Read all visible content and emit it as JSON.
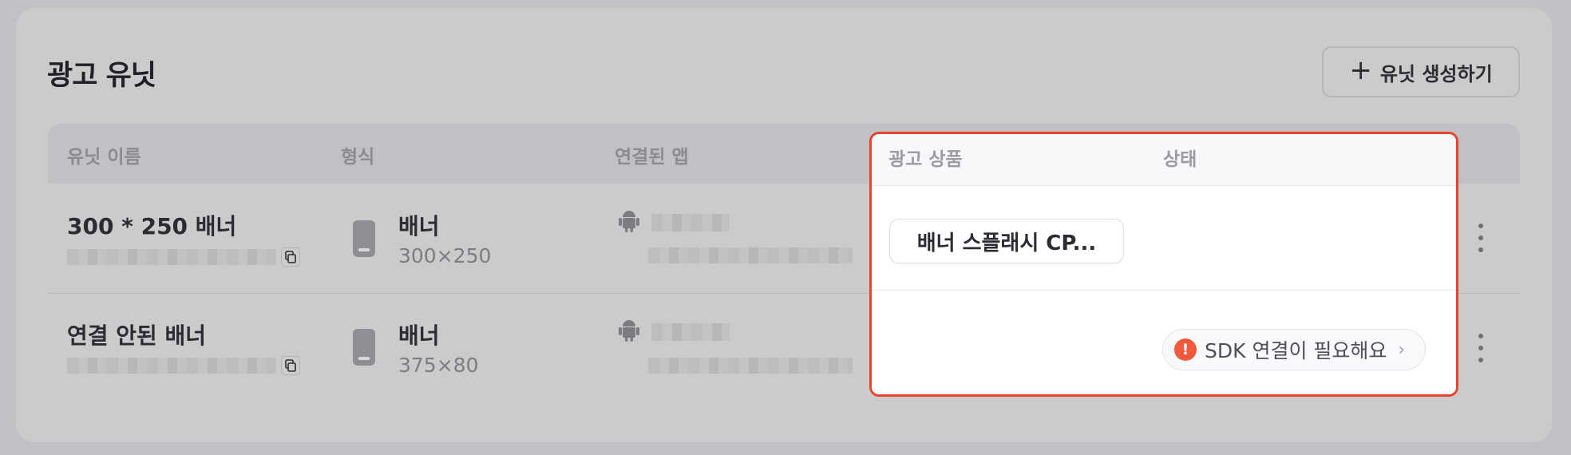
{
  "header": {
    "title": "광고 유닛",
    "create_button": "유닛 생성하기"
  },
  "table": {
    "columns": {
      "name": "유닛 이름",
      "format": "형식",
      "app": "연결된 앱",
      "product": "광고 상품",
      "status": "상태"
    },
    "rows": [
      {
        "name": "300 * 250 배너",
        "format": "배너",
        "size": "300×250",
        "product": "배너 스플래시 CP...",
        "status": ""
      },
      {
        "name": "연결 안된 배너",
        "format": "배너",
        "size": "375×80",
        "product": "",
        "status": "SDK 연결이 필요해요"
      }
    ]
  },
  "colors": {
    "highlight": "#e8432d",
    "warning": "#f05a3c"
  },
  "icons": [
    "plus-icon",
    "copy-icon",
    "phone-icon",
    "android-icon",
    "more-vertical-icon",
    "warning-icon",
    "chevron-right-icon"
  ]
}
